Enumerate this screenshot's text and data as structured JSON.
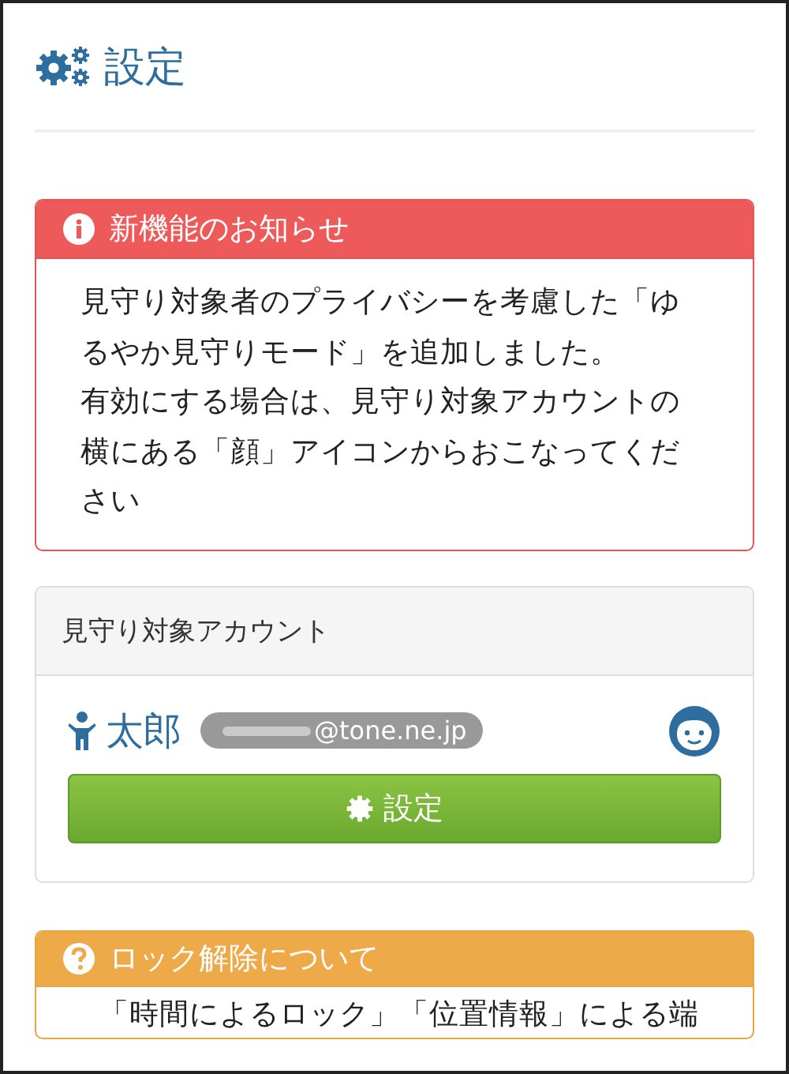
{
  "header": {
    "title": "設定"
  },
  "notice": {
    "title": "新機能のお知らせ",
    "paragraphs": [
      "見守り対象者のプライバシーを考慮した「ゆるやか見守りモード」を追加しました。",
      "有効にする場合は、見守り対象アカウントの横にある「顔」アイコンからおこなってください"
    ]
  },
  "account_panel": {
    "title": "見守り対象アカウント",
    "account": {
      "name": "太郎",
      "email": "@tone.ne.jp"
    },
    "button": "設定"
  },
  "unlock_panel": {
    "title": "ロック解除について",
    "text": "「時間によるロック」「位置情報」による端"
  }
}
